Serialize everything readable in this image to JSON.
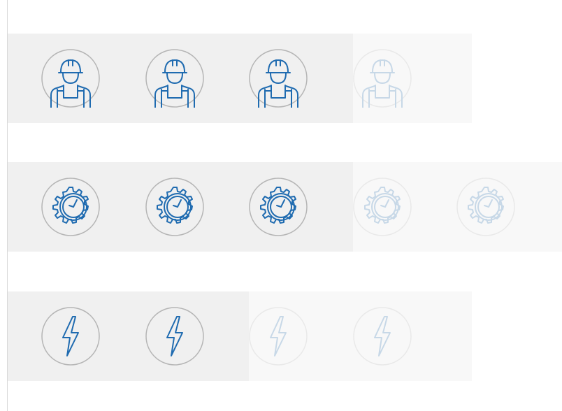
{
  "chart_data": {
    "type": "pictograph",
    "rows": [
      {
        "icon": "worker-icon",
        "filled": 3,
        "total": 4
      },
      {
        "icon": "gear-clock-icon",
        "filled": 3,
        "total": 5
      },
      {
        "icon": "lightning-bolt-icon",
        "filled": 2,
        "total": 4
      }
    ],
    "colors": {
      "icon": "#1f6bb0",
      "circle": "#b5b5b5",
      "filled_band": "#f0f0f0",
      "empty_band": "#f8f8f8"
    }
  }
}
